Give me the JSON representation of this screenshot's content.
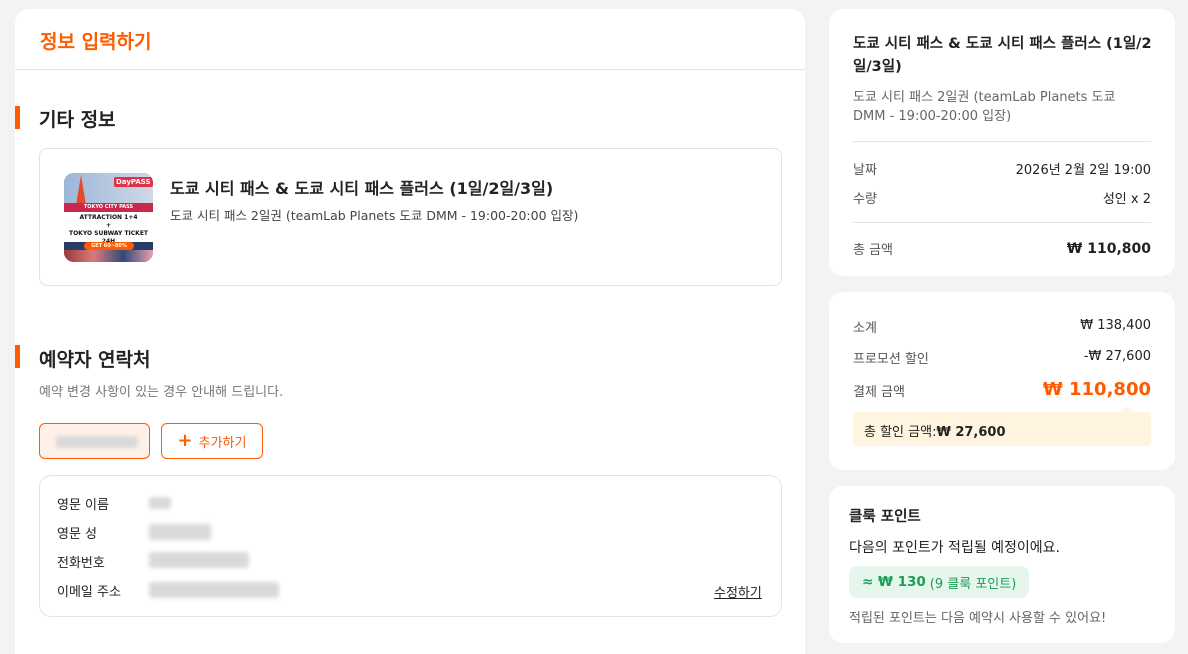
{
  "main": {
    "title": "정보 입력하기",
    "other_info": {
      "heading": "기타 정보",
      "product": {
        "name": "도쿄 시티 패스 & 도쿄 시티 패스 플러스 (1일/2일/3일)",
        "option": "도쿄 시티 패스 2일권 (teamLab Planets 도쿄 DMM - 19:00-20:00 입장)",
        "thumb_logo": "DayPASS",
        "thumb_band": "TOKYO CITY PASS",
        "thumb_line1": "ATTRACTION 1+4",
        "thumb_line2": "+",
        "thumb_line3": "TOKYO SUBWAY TICKET 24H",
        "thumb_badge": "GET 60~80% OFF!"
      }
    },
    "contact": {
      "heading": "예약자 연락처",
      "subtitle": "예약 변경 사항이 있는 경우 안내해 드립니다.",
      "add_label": "추가하기",
      "fields": [
        {
          "label": "영문 이름"
        },
        {
          "label": "영문 성"
        },
        {
          "label": "전화번호"
        },
        {
          "label": "이메일 주소"
        }
      ],
      "edit_label": "수정하기"
    }
  },
  "summary": {
    "title": "도쿄 시티 패스 & 도쿄 시티 패스 플러스 (1일/2일/3일)",
    "option": "도쿄 시티 패스 2일권 (teamLab Planets 도쿄 DMM - 19:00-20:00 입장)",
    "date_label": "날짜",
    "date_value": "2026년 2월 2일 19:00",
    "qty_label": "수량",
    "qty_value": "성인 x 2",
    "total_label": "총 금액",
    "total_value": "₩ 110,800"
  },
  "payment": {
    "subtotal_label": "소계",
    "subtotal_value": "₩ 138,400",
    "promo_label": "프로모션 할인",
    "promo_value": "-₩ 27,600",
    "pay_label": "결제 금액",
    "pay_value": "₩ 110,800",
    "discount_label": "총 할인 금액:",
    "discount_value": "₩ 27,600"
  },
  "points": {
    "title": "클룩 포인트",
    "desc": "다음의 포인트가 적립될 예정이에요.",
    "amount": "≈ ₩ 130",
    "amount_sub": "(9 클룩 포인트)",
    "note": "적립된 포인트는 다음 예약시 사용할 수 있어요!"
  },
  "colors": {
    "accent": "#ff5b00",
    "point_green": "#1f9c55",
    "point_bg": "#e5f6ec",
    "discount_bg": "#fff4df"
  }
}
